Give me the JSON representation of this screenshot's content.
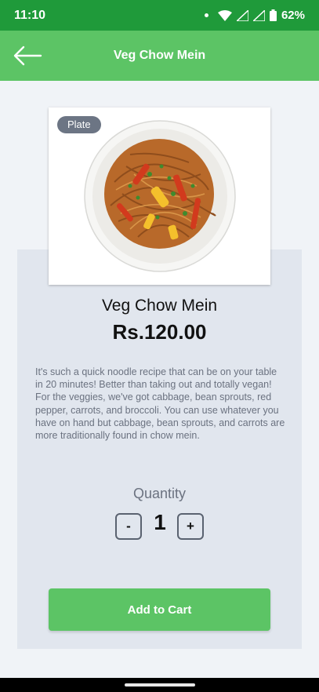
{
  "status_bar": {
    "time": "11:10",
    "battery_text": "62%"
  },
  "app_bar": {
    "title": "Veg Chow Mein",
    "back_icon": "arrow-left-icon"
  },
  "product": {
    "badge": "Plate",
    "name": "Veg Chow Mein",
    "price": "Rs.120.00",
    "description": "It's such a quick noodle recipe that can be on your table in 20 minutes! Better than taking out and totally vegan! For the veggies, we've got cabbage, bean sprouts, red pepper, carrots, and broccoli. You can use whatever you have on hand but cabbage, bean sprouts, and carrots are more traditionally found in chow mein."
  },
  "quantity": {
    "label": "Quantity",
    "minus": "-",
    "value": "1",
    "plus": "+"
  },
  "cart": {
    "button_label": "Add to Cart"
  },
  "colors": {
    "status_bar": "#1f9a3a",
    "app_bar": "#5cc465",
    "accent": "#5cc465",
    "card": "#e1e6ee"
  }
}
